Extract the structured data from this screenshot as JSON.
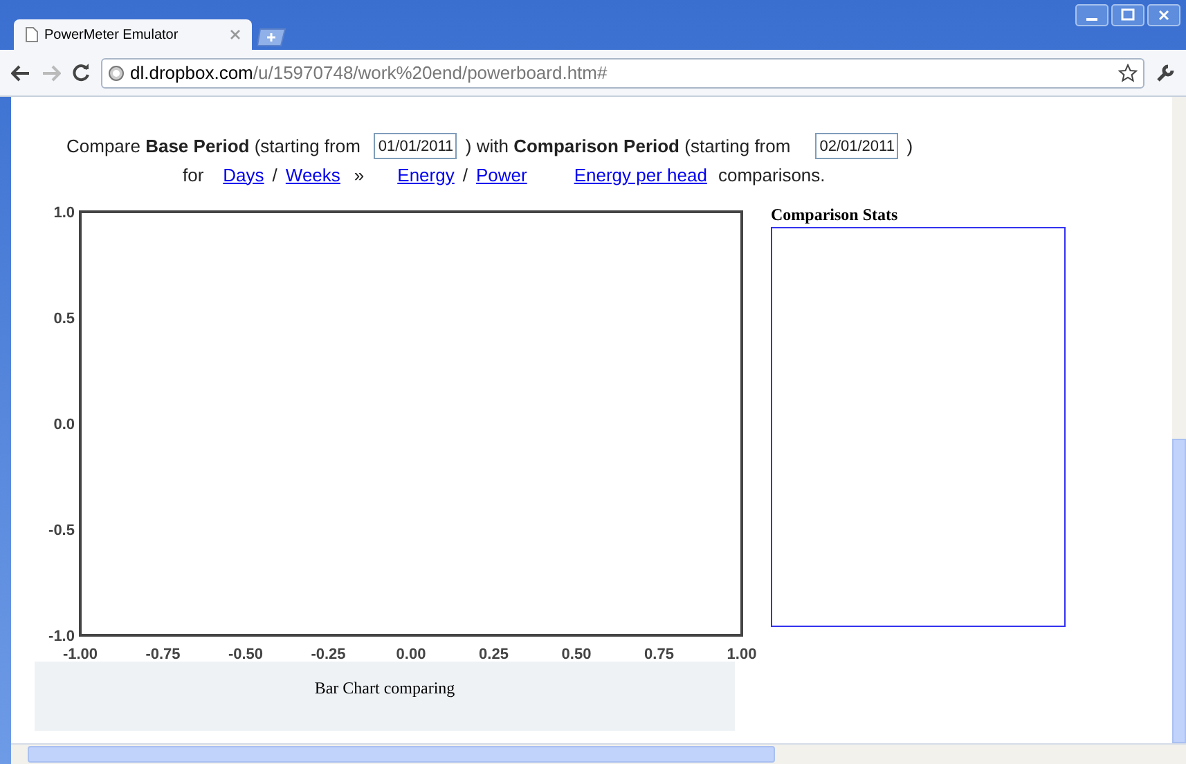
{
  "window": {
    "tab_title": "PowerMeter Emulator",
    "address_host": "dl.dropbox.com",
    "address_path": "/u/15970748/work%20end/powerboard.htm#"
  },
  "controls": {
    "line1_before": "Compare **Base Period** (starting from",
    "base_date": "01/01/2011",
    "line1_middle": ") with **Comparison Period** (starting from",
    "comparison_date": "02/01/2011",
    "line1_after": ")",
    "line2_for": "for",
    "days_link": "Days",
    "slash_1": "/",
    "weeks_link": "Weeks",
    "chevron": "»",
    "energy_link": "Energy",
    "slash_2": "/",
    "power_link": "Power",
    "energy_per_head_link": "Energy per head",
    "line2_after": "comparisons."
  },
  "chart": {
    "chart_data": {
      "type": "bar",
      "xlim": [
        -1,
        1
      ],
      "ylim": [
        -1,
        1
      ],
      "xticks": [
        {
          "value": -1,
          "label": "-1.00"
        },
        {
          "value": -0.75,
          "label": "-0.75"
        },
        {
          "value": -0.5,
          "label": "-0.50"
        },
        {
          "value": -0.25,
          "label": "-0.25"
        },
        {
          "value": 0,
          "label": "0.00"
        },
        {
          "value": 0.25,
          "label": "0.25"
        },
        {
          "value": 0.5,
          "label": "0.50"
        },
        {
          "value": 0.75,
          "label": "0.75"
        },
        {
          "value": 1,
          "label": "1.00"
        }
      ],
      "yticks": [
        {
          "value": -1,
          "label": "-1.0"
        },
        {
          "value": -0.5,
          "label": "-0.5"
        },
        {
          "value": 0,
          "label": "0.0"
        },
        {
          "value": 0.5,
          "label": "0.5"
        },
        {
          "value": 1,
          "label": "1.0"
        }
      ]
    },
    "caption": "Bar Chart comparing"
  },
  "stats": {
    "title": "Comparison Stats"
  }
}
